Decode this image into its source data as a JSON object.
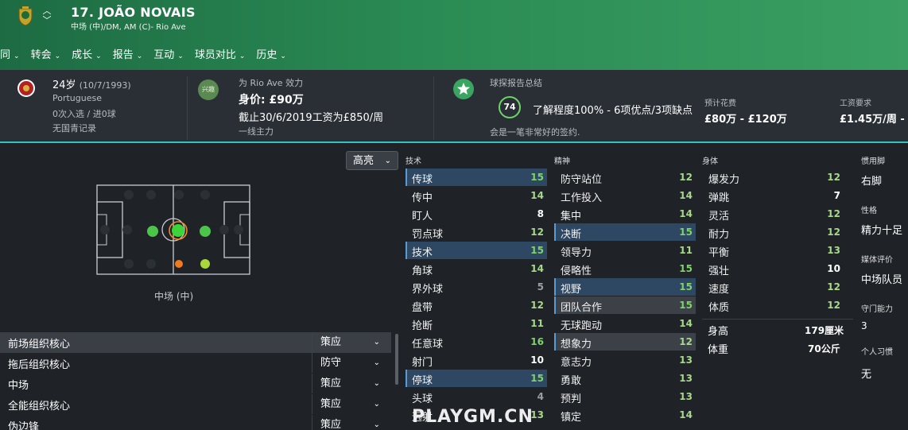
{
  "header": {
    "name": "17. JOÃO NOVAIS",
    "subtitle": "中场 (中)/DM, AM (C)- Rio Ave",
    "menu": [
      "同",
      "转会",
      "成长",
      "报告",
      "互动",
      "球员对比",
      "历史"
    ]
  },
  "info": {
    "age": "24岁",
    "dob": "(10/7/1993)",
    "nationality": "Portuguese",
    "caps": "0次入选 / 进0球",
    "youth": "无国青记录",
    "club_line": "为 Rio Ave 效力",
    "value": "身价: £90万",
    "contract": "截止30/6/2019工资为£850/周",
    "squad_status": "一线主力",
    "interest_badge": "兴趣",
    "scout_title": "球探报告总结",
    "scout_rating": "74",
    "scout_summary": "了解程度100% - 6项优点/3项缺点",
    "scout_note": "会是一笔非常好的签约.",
    "fee_label": "预计花费",
    "fee_value": "£80万 - £120万",
    "wage_label": "工资要求",
    "wage_value": "£1.45万/周 - £2"
  },
  "pitch": {
    "highlight_label": "高亮",
    "position_label": "中场 (中)"
  },
  "roles": [
    {
      "name": "前场组织核心",
      "duty": "策应"
    },
    {
      "name": "拖后组织核心",
      "duty": "防守"
    },
    {
      "name": "中场",
      "duty": "策应"
    },
    {
      "name": "全能组织核心",
      "duty": "策应"
    },
    {
      "name": "伪边锋",
      "duty": "策应"
    }
  ],
  "attributes": {
    "technical_title": "技术",
    "technical": [
      {
        "name": "传球",
        "value": "15"
      },
      {
        "name": "传中",
        "value": "14"
      },
      {
        "name": "盯人",
        "value": "8"
      },
      {
        "name": "罚点球",
        "value": "12"
      },
      {
        "name": "技术",
        "value": "15"
      },
      {
        "name": "角球",
        "value": "14"
      },
      {
        "name": "界外球",
        "value": "5"
      },
      {
        "name": "盘带",
        "value": "12"
      },
      {
        "name": "抢断",
        "value": "11"
      },
      {
        "name": "任意球",
        "value": "16"
      },
      {
        "name": "射门",
        "value": "10"
      },
      {
        "name": "停球",
        "value": "15"
      },
      {
        "name": "头球",
        "value": "4"
      },
      {
        "name": "远射",
        "value": "13"
      }
    ],
    "mental_title": "精神",
    "mental": [
      {
        "name": "防守站位",
        "value": "12"
      },
      {
        "name": "工作投入",
        "value": "14"
      },
      {
        "name": "集中",
        "value": "14"
      },
      {
        "name": "决断",
        "value": "15"
      },
      {
        "name": "领导力",
        "value": "11"
      },
      {
        "name": "侵略性",
        "value": "15"
      },
      {
        "name": "视野",
        "value": "15"
      },
      {
        "name": "团队合作",
        "value": "15"
      },
      {
        "name": "无球跑动",
        "value": "14"
      },
      {
        "name": "想象力",
        "value": "12"
      },
      {
        "name": "意志力",
        "value": "13"
      },
      {
        "name": "勇敢",
        "value": "13"
      },
      {
        "name": "预判",
        "value": "13"
      },
      {
        "name": "镇定",
        "value": "14"
      }
    ],
    "physical_title": "身体",
    "physical": [
      {
        "name": "爆发力",
        "value": "12"
      },
      {
        "name": "弹跳",
        "value": "7"
      },
      {
        "name": "灵活",
        "value": "12"
      },
      {
        "name": "耐力",
        "value": "12"
      },
      {
        "name": "平衡",
        "value": "13"
      },
      {
        "name": "强壮",
        "value": "10"
      },
      {
        "name": "速度",
        "value": "12"
      },
      {
        "name": "体质",
        "value": "12"
      }
    ],
    "height_label": "身高",
    "height_value": "179厘米",
    "weight_label": "体重",
    "weight_value": "70公斤"
  },
  "side": {
    "foot_label": "惯用脚",
    "foot_value": "右脚",
    "personality_label": "性格",
    "personality_value": "精力十足",
    "media_label": "媒体评价",
    "media_value": "中场队员",
    "gk_label": "守门能力",
    "gk_value": "3",
    "habits_label": "个人习惯",
    "habits_value": "无"
  },
  "watermark": "PLAYGM.CN",
  "colors": {
    "header_green": "#2a8a53",
    "accent_teal": "#34c2c2",
    "attr_highlight": "#2e4863",
    "value_green": "#7fd36a"
  }
}
